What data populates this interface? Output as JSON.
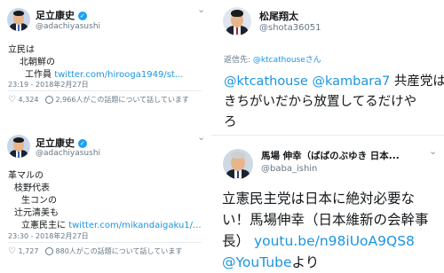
{
  "left": {
    "tweets": [
      {
        "name": "足立康史",
        "handle": "@adachiyasushi",
        "lines": [
          "立民は",
          "北朝鮮の",
          "工作員"
        ],
        "link": "twitter.com/hirooga1949/st...",
        "timestamp": "23:19 - 2018年2月27日",
        "likes": "4,324",
        "talking": "2,966人がこの話題について話しています"
      },
      {
        "name": "足立康史",
        "handle": "@adachiyasushi",
        "lines": [
          "革マルの",
          "枝野代表",
          "生コンの",
          "辻元清美も",
          "立憲民主に"
        ],
        "link": "twitter.com/mikandaigaku1/...",
        "timestamp": "23:30 - 2018年2月27日",
        "likes": "1,727",
        "talking": "880人がこの話題について話しています"
      }
    ]
  },
  "right_top": {
    "name": "松尾翔太",
    "handle": "@shota36051",
    "reply_prefix": "返信先:",
    "reply_to": "@ktcathouseさん",
    "mention_1": "@ktcathouse",
    "mention_2": "@kambara7",
    "text_after_mentions": "共産党は",
    "line2": "きちがいだから放置してるだけや",
    "line3": "ろ"
  },
  "right_bottom": {
    "name": "馬場 伸幸（ばばのぶゆき 日本...",
    "handle": "@baba_ishin",
    "line1": "立憲民主党は日本に絶対必要な",
    "line2": "い！馬場伸幸（日本維新の会幹事",
    "line3_text": "長）",
    "line3_link": "youtu.be/n98iUoA9QS8",
    "line4_link": "@YouTube",
    "line4_text": "より"
  },
  "icons": {
    "verified": "✓",
    "chevron": "⌄",
    "heart": "♡",
    "person": "person-icon"
  },
  "colors": {
    "link": "#1b95e0",
    "verified": "#1da1f2",
    "meta": "#657786"
  }
}
